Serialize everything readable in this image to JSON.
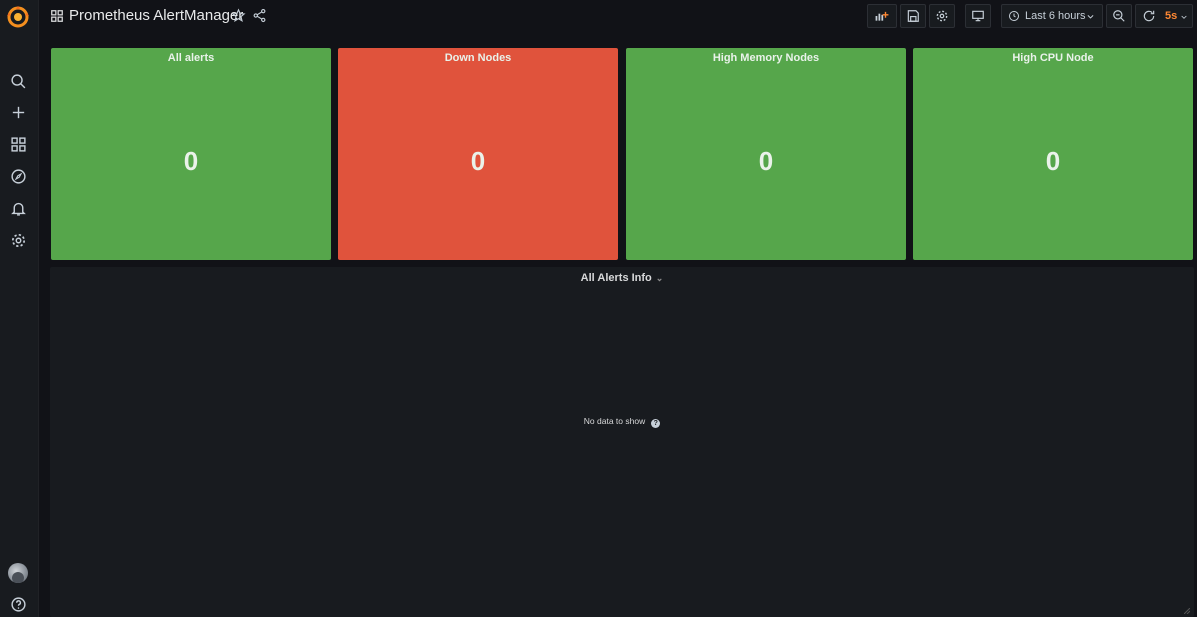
{
  "header": {
    "title": "Prometheus AlertManager",
    "time_range": "Last 6 hours",
    "refresh_interval": "5s"
  },
  "panels": [
    {
      "title": "All alerts",
      "value": "0",
      "color": "#56a64b"
    },
    {
      "title": "Down Nodes",
      "value": "0",
      "color": "#e0533c"
    },
    {
      "title": "High Memory Nodes",
      "value": "0",
      "color": "#56a64b"
    },
    {
      "title": "High CPU Node",
      "value": "0",
      "color": "#56a64b"
    }
  ],
  "table_panel": {
    "title": "All Alerts Info",
    "empty_message": "No data to show"
  },
  "colors": {
    "background": "#111217",
    "panel_bg": "#181b1f",
    "accent": "#ff8833"
  },
  "icons": [
    "grafana-logo-icon",
    "search-icon",
    "plus-icon",
    "dashboards-icon",
    "explore-icon",
    "bell-icon",
    "gear-icon",
    "help-icon",
    "star-icon",
    "share-icon",
    "add-panel-icon",
    "save-icon",
    "settings-icon",
    "tv-icon",
    "clock-icon",
    "zoom-out-icon",
    "refresh-icon"
  ]
}
